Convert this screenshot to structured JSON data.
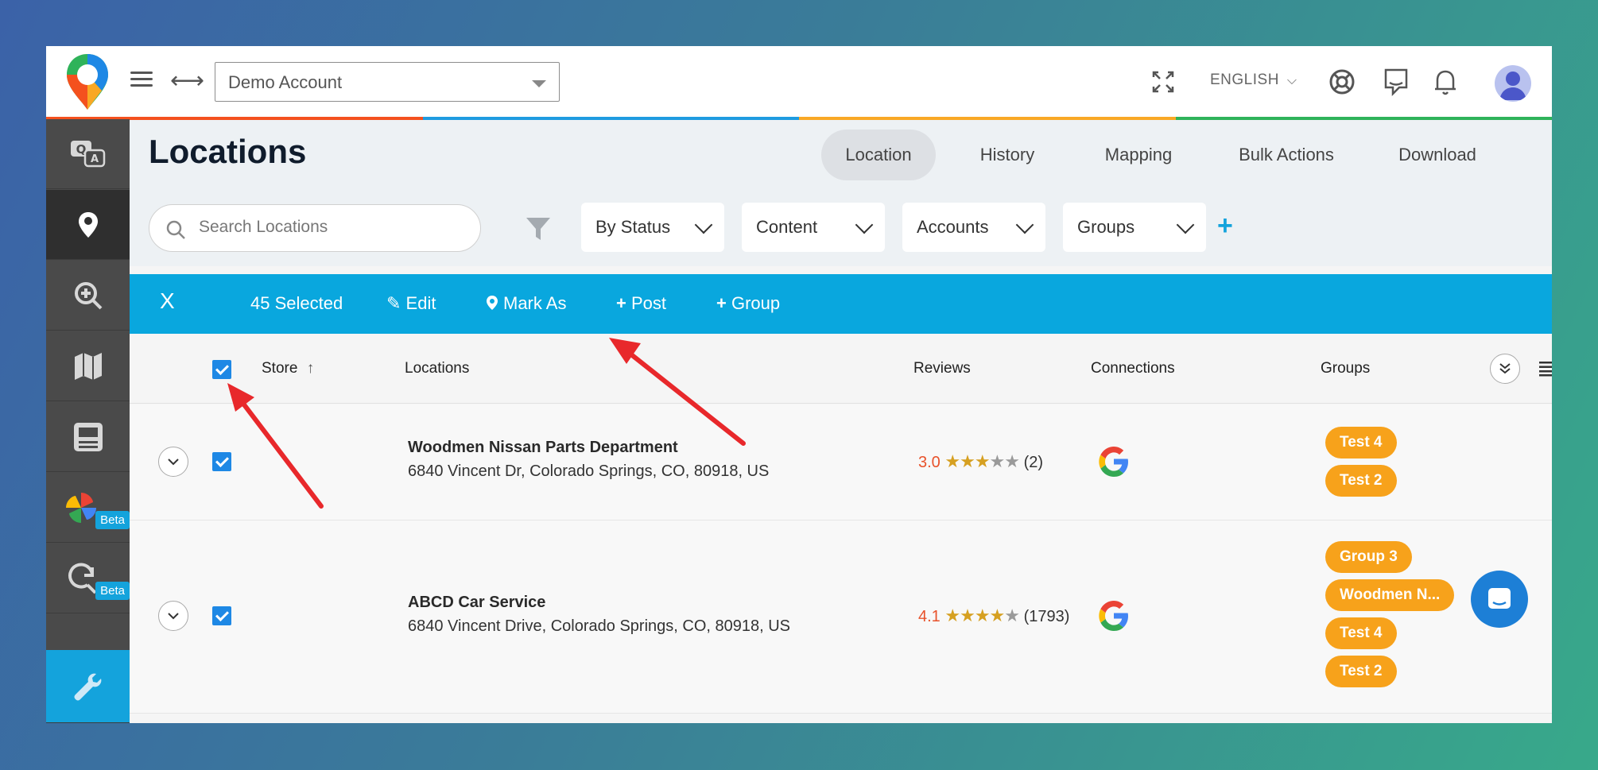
{
  "header": {
    "account": "Demo Account",
    "language": "ENGLISH"
  },
  "sidebar": {
    "items": [
      {
        "icon": "qa-icon"
      },
      {
        "icon": "location-pin-icon"
      },
      {
        "icon": "zoom-in-icon"
      },
      {
        "icon": "map-icon"
      },
      {
        "icon": "listing-icon"
      },
      {
        "icon": "photos-pinwheel-icon",
        "badge": "Beta"
      },
      {
        "icon": "search-refresh-icon",
        "badge": "Beta"
      },
      {
        "icon": "wrench-icon"
      }
    ]
  },
  "page": {
    "title": "Locations",
    "tabs": [
      "Location",
      "History",
      "Mapping",
      "Bulk Actions",
      "Download"
    ],
    "active_tab": "Location"
  },
  "filters": {
    "search_placeholder": "Search Locations",
    "dropdowns": [
      "By Status",
      "Content",
      "Accounts",
      "Groups"
    ]
  },
  "actions": {
    "close": "X",
    "selected": "45 Selected",
    "edit": "Edit",
    "mark_as": "Mark As",
    "post": "Post",
    "group": "Group"
  },
  "table": {
    "columns": {
      "store": "Store",
      "locations": "Locations",
      "reviews": "Reviews",
      "connections": "Connections",
      "groups": "Groups"
    },
    "rows": [
      {
        "name": "Woodmen Nissan Parts Department",
        "address": "6840 Vincent Dr, Colorado Springs, CO, 80918, US",
        "rating": "3.0",
        "stars": 3,
        "count": "(2)",
        "groups": [
          "Test 4",
          "Test 2"
        ]
      },
      {
        "name": "ABCD Car Service",
        "address": "6840 Vincent Drive, Colorado Springs, CO, 80918, US",
        "rating": "4.1",
        "stars": 4,
        "count": "(1793)",
        "groups": [
          "Group 3",
          "Woodmen N...",
          "Test 4",
          "Test 2"
        ]
      }
    ]
  },
  "colors": {
    "accent": "#09a7de",
    "tag": "#f7a21b",
    "sidebar": "#4a4a4a",
    "rating": "#e8522b",
    "annotation_arrow": "#e8282b"
  }
}
